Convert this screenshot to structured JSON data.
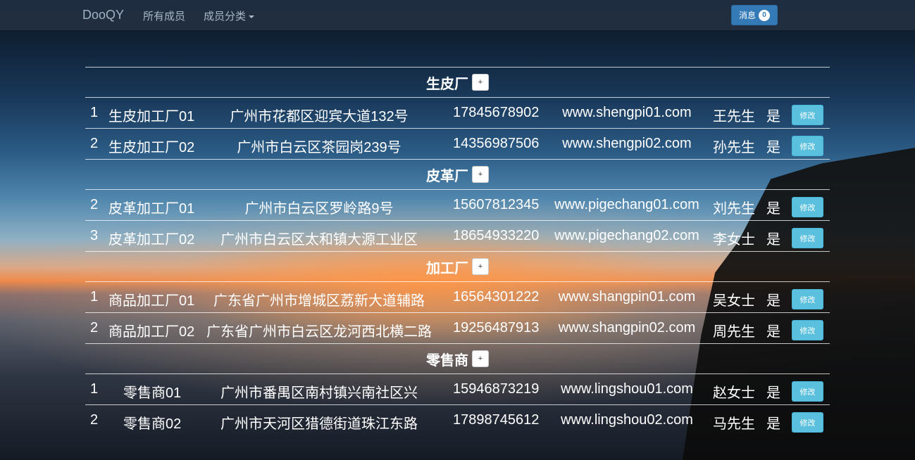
{
  "navbar": {
    "brand": "DooQY",
    "all_members": "所有成员",
    "member_category": "成员分类",
    "messages_label": "消息",
    "messages_count": "0"
  },
  "add_label": "+",
  "edit_label": "修改",
  "categories": [
    {
      "title": "生皮厂",
      "rows": [
        {
          "idx": "1",
          "name": "生皮加工厂01",
          "address": "广州市花都区迎宾大道132号",
          "phone": "17845678902",
          "website": "www.shengpi01.com",
          "contact": "王先生",
          "flag": "是"
        },
        {
          "idx": "2",
          "name": "生皮加工厂02",
          "address": "广州市白云区茶园岗239号",
          "phone": "14356987506",
          "website": "www.shengpi02.com",
          "contact": "孙先生",
          "flag": "是"
        }
      ]
    },
    {
      "title": "皮革厂",
      "rows": [
        {
          "idx": "2",
          "name": "皮革加工厂01",
          "address": "广州市白云区罗岭路9号",
          "phone": "15607812345",
          "website": "www.pigechang01.com",
          "contact": "刘先生",
          "flag": "是"
        },
        {
          "idx": "3",
          "name": "皮革加工厂02",
          "address": "广州市白云区太和镇大源工业区",
          "phone": "18654933220",
          "website": "www.pigechang02.com",
          "contact": "李女士",
          "flag": "是"
        }
      ]
    },
    {
      "title": "加工厂",
      "rows": [
        {
          "idx": "1",
          "name": "商品加工厂01",
          "address": "广东省广州市增城区荔新大道辅路",
          "phone": "16564301222",
          "website": "www.shangpin01.com",
          "contact": "吴女士",
          "flag": "是"
        },
        {
          "idx": "2",
          "name": "商品加工厂02",
          "address": "广东省广州市白云区龙河西北横二路",
          "phone": "19256487913",
          "website": "www.shangpin02.com",
          "contact": "周先生",
          "flag": "是"
        }
      ]
    },
    {
      "title": "零售商",
      "rows": [
        {
          "idx": "1",
          "name": "零售商01",
          "address": "广州市番禺区南村镇兴南社区兴",
          "phone": "15946873219",
          "website": "www.lingshou01.com",
          "contact": "赵女士",
          "flag": "是"
        },
        {
          "idx": "2",
          "name": "零售商02",
          "address": "广州市天河区猎德街道珠江东路",
          "phone": "17898745612",
          "website": "www.lingshou02.com",
          "contact": "马先生",
          "flag": "是"
        }
      ]
    }
  ]
}
